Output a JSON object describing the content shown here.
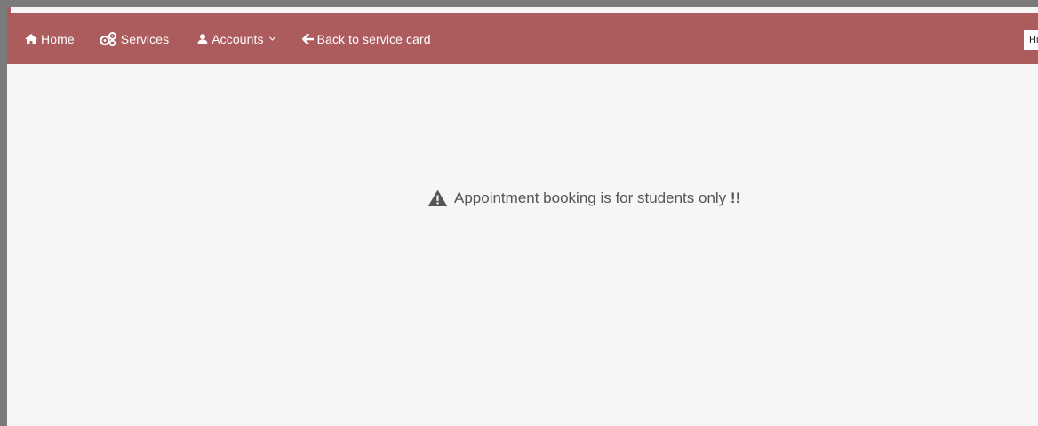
{
  "navbar": {
    "items": [
      {
        "label": "Home",
        "icon": "home-icon"
      },
      {
        "label": "Services",
        "icon": "services-icon"
      },
      {
        "label": "Accounts",
        "icon": "user-icon",
        "has_dropdown": true
      },
      {
        "label": "Back to service card",
        "icon": "arrow-left-icon"
      }
    ],
    "user_greeting": "Hi,"
  },
  "notice": {
    "message": "Appointment booking is for students only",
    "suffix": "!!",
    "icon": "warning-icon"
  },
  "colors": {
    "navbar_bg": "#ad5c5e",
    "page_bg": "#f6f6f6",
    "frame": "#7a7a7a",
    "notice_text": "#555555"
  }
}
